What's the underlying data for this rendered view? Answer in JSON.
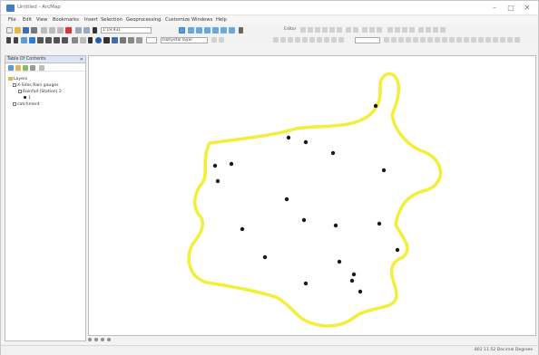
{
  "window": {
    "title": "Untitled - ArcMap"
  },
  "menubar": {
    "items": [
      "File",
      "Edit",
      "View",
      "Bookmarks",
      "Insert",
      "Selection",
      "Geoprocessing",
      "Customize",
      "Windows",
      "Help"
    ]
  },
  "toolbar": {
    "scale_value": "1:19,931",
    "layer_dropdown": "Isohyetal layer",
    "editor_label": "Editor"
  },
  "toc": {
    "title": "Table Of Contents",
    "close": "✕",
    "layers_group": "Layers",
    "layer1": "X-Sites Rain gauges",
    "layer1_sub": "Rainfall (Station) 2",
    "layer1_legend": "1",
    "layer2": "catchment"
  },
  "map": {
    "boundary_color": "#f2ee3a",
    "point_color": "#1a1a1a"
  },
  "status": {
    "coordinates": "802  11.52 Decimal Degrees"
  }
}
